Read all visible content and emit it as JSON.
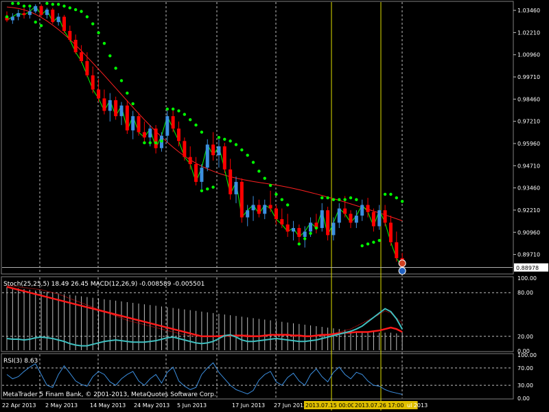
{
  "window": {
    "copyright": "MetaTrader 5 Finam Bank, © 2001-2013, MetaQuotes Software Corp."
  },
  "colors": {
    "background": "#000000",
    "bull_candle": "#3c8fe0",
    "bear_candle": "#ff0000",
    "parabolic_sar": "#00ff00",
    "close_line": "#00ff00",
    "moving_average": "#ff2020",
    "grid": "#c0c0c0",
    "vline": "#e0e000",
    "stoch_main": "#ff1a1a",
    "stoch_signal": "#ff1a1a",
    "macd_line": "#40c0c0",
    "macd_hist": "#c0c0c0",
    "rsi_line": "#3c8fe0"
  },
  "chart_data": [
    {
      "type": "candlestick",
      "panel": "main",
      "y_ticks": [
        "1.03460",
        "1.02210",
        "1.00960",
        "0.99710",
        "0.98460",
        "0.97210",
        "0.95960",
        "0.94710",
        "0.93460",
        "0.92210",
        "0.90960",
        "0.89710"
      ],
      "ylim": [
        0.8865,
        1.0385
      ],
      "current_price": "0.88978",
      "x_labels": [
        "22 Apr 2013",
        "2 May 2013",
        "14 May 2013",
        "24 May 2013",
        "5 Jun 2013",
        "17 Jun 2013",
        "27 Jun 2013",
        "2013.07.15 00:00",
        "2013.07.26 17:00",
        "ul 2013"
      ],
      "highlighted_labels": [
        "2013.07.15 00:00",
        "2013.07.26 17:00"
      ],
      "candles": [
        [
          1.031,
          1.034,
          1.028,
          1.029
        ],
        [
          1.029,
          1.033,
          1.027,
          1.031
        ],
        [
          1.031,
          1.035,
          1.029,
          1.033
        ],
        [
          1.033,
          1.036,
          1.03,
          1.032
        ],
        [
          1.032,
          1.036,
          1.03,
          1.034
        ],
        [
          1.034,
          1.038,
          1.033,
          1.037
        ],
        [
          1.037,
          1.038,
          1.031,
          1.032
        ],
        [
          1.032,
          1.036,
          1.03,
          1.035
        ],
        [
          1.035,
          1.036,
          1.027,
          1.028
        ],
        [
          1.028,
          1.033,
          1.026,
          1.031
        ],
        [
          1.031,
          1.032,
          1.022,
          1.023
        ],
        [
          1.023,
          1.026,
          1.017,
          1.018
        ],
        [
          1.018,
          1.021,
          1.01,
          1.011
        ],
        [
          1.011,
          1.015,
          1.005,
          1.006
        ],
        [
          1.006,
          1.011,
          0.997,
          0.998
        ],
        [
          0.998,
          1.003,
          0.988,
          0.99
        ],
        [
          0.99,
          0.996,
          0.983,
          0.985
        ],
        [
          0.985,
          0.99,
          0.976,
          0.978
        ],
        [
          0.978,
          0.988,
          0.972,
          0.984
        ],
        [
          0.984,
          0.986,
          0.973,
          0.975
        ],
        [
          0.975,
          0.983,
          0.97,
          0.981
        ],
        [
          0.981,
          0.984,
          0.965,
          0.967
        ],
        [
          0.967,
          0.978,
          0.962,
          0.975
        ],
        [
          0.975,
          0.977,
          0.964,
          0.966
        ],
        [
          0.966,
          0.972,
          0.96,
          0.963
        ],
        [
          0.963,
          0.97,
          0.958,
          0.968
        ],
        [
          0.968,
          0.97,
          0.954,
          0.957
        ],
        [
          0.957,
          0.966,
          0.955,
          0.964
        ],
        [
          0.964,
          0.978,
          0.96,
          0.975
        ],
        [
          0.975,
          0.978,
          0.966,
          0.968
        ],
        [
          0.968,
          0.972,
          0.958,
          0.961
        ],
        [
          0.961,
          0.963,
          0.95,
          0.952
        ],
        [
          0.952,
          0.958,
          0.945,
          0.948
        ],
        [
          0.948,
          0.952,
          0.936,
          0.938
        ],
        [
          0.938,
          0.948,
          0.934,
          0.946
        ],
        [
          0.946,
          0.962,
          0.944,
          0.959
        ],
        [
          0.959,
          0.966,
          0.95,
          0.953
        ],
        [
          0.953,
          0.962,
          0.946,
          0.958
        ],
        [
          0.958,
          0.96,
          0.943,
          0.945
        ],
        [
          0.945,
          0.951,
          0.928,
          0.931
        ],
        [
          0.931,
          0.941,
          0.926,
          0.938
        ],
        [
          0.938,
          0.94,
          0.915,
          0.918
        ],
        [
          0.918,
          0.925,
          0.913,
          0.922
        ],
        [
          0.922,
          0.93,
          0.916,
          0.925
        ],
        [
          0.925,
          0.928,
          0.918,
          0.92
        ],
        [
          0.92,
          0.928,
          0.917,
          0.925
        ],
        [
          0.925,
          0.933,
          0.921,
          0.923
        ],
        [
          0.923,
          0.925,
          0.914,
          0.917
        ],
        [
          0.917,
          0.923,
          0.912,
          0.914
        ],
        [
          0.914,
          0.92,
          0.907,
          0.91
        ],
        [
          0.91,
          0.916,
          0.905,
          0.912
        ],
        [
          0.912,
          0.914,
          0.904,
          0.907
        ],
        [
          0.907,
          0.913,
          0.901,
          0.91
        ],
        [
          0.91,
          0.918,
          0.907,
          0.915
        ],
        [
          0.915,
          0.92,
          0.909,
          0.912
        ],
        [
          0.912,
          0.926,
          0.91,
          0.922
        ],
        [
          0.922,
          0.924,
          0.905,
          0.908
        ],
        [
          0.908,
          0.918,
          0.905,
          0.915
        ],
        [
          0.915,
          0.926,
          0.912,
          0.923
        ],
        [
          0.923,
          0.93,
          0.918,
          0.92
        ],
        [
          0.92,
          0.922,
          0.912,
          0.915
        ],
        [
          0.915,
          0.922,
          0.912,
          0.919
        ],
        [
          0.919,
          0.928,
          0.916,
          0.925
        ],
        [
          0.925,
          0.929,
          0.918,
          0.921
        ],
        [
          0.921,
          0.923,
          0.91,
          0.913
        ],
        [
          0.913,
          0.925,
          0.911,
          0.922
        ],
        [
          0.922,
          0.925,
          0.913,
          0.915
        ],
        [
          0.915,
          0.919,
          0.902,
          0.904
        ],
        [
          0.904,
          0.91,
          0.893,
          0.895
        ],
        [
          0.895,
          0.898,
          0.888,
          0.89
        ]
      ],
      "sar": [
        [
          0,
          1.031
        ],
        [
          1,
          1.0385
        ],
        [
          2,
          1.0385
        ],
        [
          3,
          1.037
        ],
        [
          4,
          1.037
        ],
        [
          5,
          1.028
        ],
        [
          6,
          1.026
        ],
        [
          7,
          1.0385
        ],
        [
          8,
          1.038
        ],
        [
          9,
          1.038
        ],
        [
          10,
          1.037
        ],
        [
          11,
          1.036
        ],
        [
          12,
          1.035
        ],
        [
          13,
          1.034
        ],
        [
          14,
          1.031
        ],
        [
          15,
          1.027
        ],
        [
          16,
          1.022
        ],
        [
          17,
          1.016
        ],
        [
          18,
          1.009
        ],
        [
          19,
          1.002
        ],
        [
          20,
          0.995
        ],
        [
          21,
          0.988
        ],
        [
          22,
          0.982
        ],
        [
          24,
          0.96
        ],
        [
          25,
          0.96
        ],
        [
          26,
          0.96
        ],
        [
          27,
          0.961
        ],
        [
          28,
          0.979
        ],
        [
          29,
          0.979
        ],
        [
          30,
          0.978
        ],
        [
          31,
          0.976
        ],
        [
          32,
          0.973
        ],
        [
          33,
          0.97
        ],
        [
          34,
          0.966
        ],
        [
          34,
          0.933
        ],
        [
          35,
          0.934
        ],
        [
          36,
          0.935
        ],
        [
          37,
          0.963
        ],
        [
          38,
          0.962
        ],
        [
          39,
          0.961
        ],
        [
          40,
          0.959
        ],
        [
          41,
          0.956
        ],
        [
          42,
          0.953
        ],
        [
          43,
          0.949
        ],
        [
          44,
          0.944
        ],
        [
          45,
          0.94
        ],
        [
          46,
          0.936
        ],
        [
          47,
          0.931
        ],
        [
          48,
          0.928
        ],
        [
          49,
          0.925
        ],
        [
          51,
          0.903
        ],
        [
          52,
          0.906
        ],
        [
          53,
          0.909
        ],
        [
          54,
          0.912
        ],
        [
          55,
          0.929
        ],
        [
          56,
          0.929
        ],
        [
          57,
          0.928
        ],
        [
          58,
          0.928
        ],
        [
          59,
          0.928
        ],
        [
          60,
          0.929
        ],
        [
          61,
          0.928
        ],
        [
          62,
          0.902
        ],
        [
          63,
          0.903
        ],
        [
          64,
          0.904
        ],
        [
          65,
          0.905
        ],
        [
          66,
          0.931
        ],
        [
          67,
          0.931
        ],
        [
          68,
          0.929
        ],
        [
          69,
          0.927
        ]
      ],
      "moving_average": [
        1.0365,
        1.0362,
        1.0357,
        1.0349,
        1.0338,
        1.0324,
        1.0306,
        1.0286,
        1.0263,
        1.0238,
        1.0211,
        1.0182,
        1.0151,
        1.0118,
        1.0084,
        1.005,
        1.0015,
        0.998,
        0.9944,
        0.9908,
        0.9872,
        0.9836,
        0.98,
        0.9765,
        0.973,
        0.9697,
        0.9664,
        0.9633,
        0.9603,
        0.9575,
        0.9549,
        0.9525,
        0.9504,
        0.9485,
        0.9468,
        0.9453,
        0.944,
        0.9428,
        0.9418,
        0.9409,
        0.9401,
        0.9394,
        0.9388,
        0.9382,
        0.9377,
        0.9372,
        0.9367,
        0.9362,
        0.9356,
        0.935,
        0.9343,
        0.9336,
        0.9328,
        0.932,
        0.9312,
        0.9303,
        0.9294,
        0.9285,
        0.9276,
        0.9266,
        0.9256,
        0.9246,
        0.9236,
        0.9226,
        0.9215,
        0.9205,
        0.9194,
        0.9183,
        0.9172,
        0.9161
      ]
    },
    {
      "type": "line",
      "panel": "oscillators",
      "label": "Stoch(25,25,5) 18.49 26.45 MACD(12,26,9) -0.008589 -0.005501",
      "y_ticks": [
        "100.00",
        "80.00",
        "20.00",
        "0.00"
      ],
      "ylim": [
        0,
        100
      ],
      "stoch_main": [
        88,
        86,
        84,
        82,
        80,
        78,
        76,
        74,
        72,
        70,
        68,
        66,
        64,
        62,
        60,
        58,
        56,
        54,
        52,
        50,
        48,
        46,
        44,
        42,
        40,
        38,
        36,
        34,
        32,
        30,
        28,
        26,
        24,
        22,
        20,
        20,
        20,
        20,
        21,
        21,
        21,
        21,
        20,
        20,
        20,
        21,
        22,
        22,
        22,
        22,
        21,
        21,
        20,
        20,
        21,
        22,
        22,
        23,
        24,
        25,
        25,
        26,
        26,
        26,
        27,
        28,
        30,
        32,
        30,
        26
      ],
      "stoch_signal": [
        90,
        89,
        88,
        87,
        86,
        85,
        84,
        82,
        80,
        78,
        75,
        72,
        69,
        66,
        63,
        60,
        57,
        54,
        51,
        48,
        45,
        42,
        40,
        38,
        36,
        34,
        32,
        30,
        28,
        26,
        24,
        22,
        21,
        20,
        20,
        20,
        20,
        21,
        21,
        21,
        22,
        22,
        22,
        21,
        21,
        22,
        22,
        23,
        23,
        23,
        22,
        22,
        21,
        21,
        22,
        23,
        23,
        24,
        26,
        28,
        30,
        34,
        38,
        42,
        46,
        50,
        55,
        52,
        45,
        38
      ],
      "macd_line": [
        17,
        16,
        16,
        15,
        16,
        18,
        19,
        18,
        17,
        15,
        13,
        10,
        8,
        7,
        7,
        9,
        11,
        13,
        14,
        15,
        14,
        13,
        12,
        12,
        12,
        13,
        14,
        16,
        18,
        19,
        17,
        15,
        13,
        11,
        10,
        11,
        13,
        17,
        21,
        22,
        19,
        15,
        13,
        13,
        14,
        15,
        16,
        17,
        16,
        15,
        14,
        13,
        13,
        14,
        15,
        17,
        19,
        21,
        23,
        25,
        27,
        30,
        34,
        40,
        46,
        52,
        58,
        54,
        44,
        30
      ],
      "macd_hist": [
        88,
        87,
        86,
        85,
        84,
        83,
        82,
        81,
        80,
        79,
        78,
        77,
        76,
        75,
        74,
        73,
        72,
        71,
        70,
        69,
        68,
        67,
        66,
        65,
        64,
        63,
        62,
        61,
        60,
        59,
        58,
        57,
        56,
        55,
        54,
        53,
        52,
        51,
        50,
        49,
        48,
        47,
        46,
        45,
        44,
        43,
        42,
        41,
        40,
        39,
        38,
        37,
        36,
        35,
        34,
        33,
        32,
        31,
        30,
        29,
        28,
        27,
        27,
        26,
        26,
        25,
        25,
        25,
        24,
        24
      ]
    },
    {
      "type": "line",
      "panel": "rsi",
      "label": "RSI(3) 8.63",
      "y_ticks": [
        "100.00",
        "70.00",
        "30.00",
        "0.00"
      ],
      "ylim": [
        0,
        100
      ],
      "values": [
        55,
        45,
        50,
        62,
        72,
        80,
        55,
        30,
        25,
        55,
        75,
        58,
        40,
        32,
        28,
        50,
        62,
        55,
        38,
        30,
        45,
        55,
        62,
        40,
        30,
        45,
        55,
        35,
        60,
        72,
        40,
        28,
        20,
        25,
        55,
        70,
        82,
        60,
        45,
        30,
        20,
        15,
        10,
        18,
        42,
        55,
        62,
        38,
        30,
        48,
        58,
        40,
        30,
        55,
        68,
        50,
        38,
        60,
        72,
        55,
        45,
        60,
        55,
        40,
        30,
        28,
        20,
        15,
        12,
        9
      ]
    }
  ]
}
